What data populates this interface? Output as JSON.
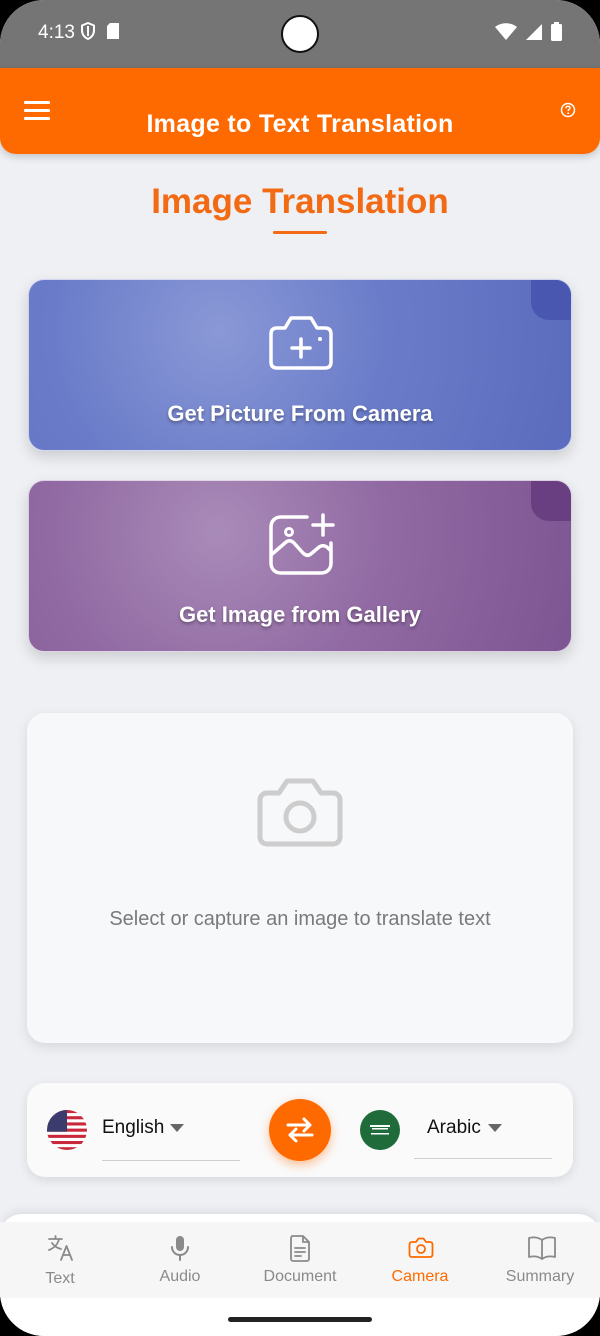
{
  "status_bar": {
    "time": "4:13"
  },
  "app_bar": {
    "title": "Image to Text Translation"
  },
  "section": {
    "title": "Image Translation"
  },
  "cards": {
    "camera_label": "Get Picture From Camera",
    "gallery_label": "Get Image from Gallery"
  },
  "preview": {
    "placeholder": "Select or capture an image to translate text"
  },
  "languages": {
    "source": "English",
    "target": "Arabic"
  },
  "bottom_nav": {
    "items": [
      {
        "label": "Text"
      },
      {
        "label": "Audio"
      },
      {
        "label": "Document"
      },
      {
        "label": "Camera"
      },
      {
        "label": "Summary"
      }
    ],
    "active": "Camera"
  },
  "colors": {
    "primary": "#ff6a00",
    "camera_card": "#6a7cc9",
    "gallery_card": "#916aa3",
    "status_bar": "#757575"
  },
  "icons": {
    "menu": "hamburger-menu-icon",
    "help": "help-circle-icon",
    "camera_card": "camera-plus-icon",
    "gallery_card": "image-plus-icon",
    "preview": "camera-icon",
    "swap": "swap-arrows-icon",
    "nav": [
      "translate-icon",
      "microphone-icon",
      "document-icon",
      "camera-icon",
      "book-open-icon"
    ]
  }
}
